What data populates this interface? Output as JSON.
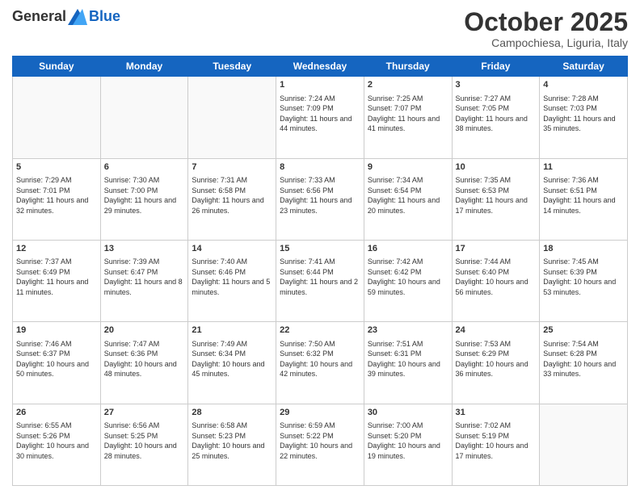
{
  "header": {
    "logo_general": "General",
    "logo_blue": "Blue",
    "month_title": "October 2025",
    "location": "Campochiesa, Liguria, Italy"
  },
  "weekdays": [
    "Sunday",
    "Monday",
    "Tuesday",
    "Wednesday",
    "Thursday",
    "Friday",
    "Saturday"
  ],
  "weeks": [
    [
      {
        "day": "",
        "info": ""
      },
      {
        "day": "",
        "info": ""
      },
      {
        "day": "",
        "info": ""
      },
      {
        "day": "1",
        "info": "Sunrise: 7:24 AM\nSunset: 7:09 PM\nDaylight: 11 hours and 44 minutes."
      },
      {
        "day": "2",
        "info": "Sunrise: 7:25 AM\nSunset: 7:07 PM\nDaylight: 11 hours and 41 minutes."
      },
      {
        "day": "3",
        "info": "Sunrise: 7:27 AM\nSunset: 7:05 PM\nDaylight: 11 hours and 38 minutes."
      },
      {
        "day": "4",
        "info": "Sunrise: 7:28 AM\nSunset: 7:03 PM\nDaylight: 11 hours and 35 minutes."
      }
    ],
    [
      {
        "day": "5",
        "info": "Sunrise: 7:29 AM\nSunset: 7:01 PM\nDaylight: 11 hours and 32 minutes."
      },
      {
        "day": "6",
        "info": "Sunrise: 7:30 AM\nSunset: 7:00 PM\nDaylight: 11 hours and 29 minutes."
      },
      {
        "day": "7",
        "info": "Sunrise: 7:31 AM\nSunset: 6:58 PM\nDaylight: 11 hours and 26 minutes."
      },
      {
        "day": "8",
        "info": "Sunrise: 7:33 AM\nSunset: 6:56 PM\nDaylight: 11 hours and 23 minutes."
      },
      {
        "day": "9",
        "info": "Sunrise: 7:34 AM\nSunset: 6:54 PM\nDaylight: 11 hours and 20 minutes."
      },
      {
        "day": "10",
        "info": "Sunrise: 7:35 AM\nSunset: 6:53 PM\nDaylight: 11 hours and 17 minutes."
      },
      {
        "day": "11",
        "info": "Sunrise: 7:36 AM\nSunset: 6:51 PM\nDaylight: 11 hours and 14 minutes."
      }
    ],
    [
      {
        "day": "12",
        "info": "Sunrise: 7:37 AM\nSunset: 6:49 PM\nDaylight: 11 hours and 11 minutes."
      },
      {
        "day": "13",
        "info": "Sunrise: 7:39 AM\nSunset: 6:47 PM\nDaylight: 11 hours and 8 minutes."
      },
      {
        "day": "14",
        "info": "Sunrise: 7:40 AM\nSunset: 6:46 PM\nDaylight: 11 hours and 5 minutes."
      },
      {
        "day": "15",
        "info": "Sunrise: 7:41 AM\nSunset: 6:44 PM\nDaylight: 11 hours and 2 minutes."
      },
      {
        "day": "16",
        "info": "Sunrise: 7:42 AM\nSunset: 6:42 PM\nDaylight: 10 hours and 59 minutes."
      },
      {
        "day": "17",
        "info": "Sunrise: 7:44 AM\nSunset: 6:40 PM\nDaylight: 10 hours and 56 minutes."
      },
      {
        "day": "18",
        "info": "Sunrise: 7:45 AM\nSunset: 6:39 PM\nDaylight: 10 hours and 53 minutes."
      }
    ],
    [
      {
        "day": "19",
        "info": "Sunrise: 7:46 AM\nSunset: 6:37 PM\nDaylight: 10 hours and 50 minutes."
      },
      {
        "day": "20",
        "info": "Sunrise: 7:47 AM\nSunset: 6:36 PM\nDaylight: 10 hours and 48 minutes."
      },
      {
        "day": "21",
        "info": "Sunrise: 7:49 AM\nSunset: 6:34 PM\nDaylight: 10 hours and 45 minutes."
      },
      {
        "day": "22",
        "info": "Sunrise: 7:50 AM\nSunset: 6:32 PM\nDaylight: 10 hours and 42 minutes."
      },
      {
        "day": "23",
        "info": "Sunrise: 7:51 AM\nSunset: 6:31 PM\nDaylight: 10 hours and 39 minutes."
      },
      {
        "day": "24",
        "info": "Sunrise: 7:53 AM\nSunset: 6:29 PM\nDaylight: 10 hours and 36 minutes."
      },
      {
        "day": "25",
        "info": "Sunrise: 7:54 AM\nSunset: 6:28 PM\nDaylight: 10 hours and 33 minutes."
      }
    ],
    [
      {
        "day": "26",
        "info": "Sunrise: 6:55 AM\nSunset: 5:26 PM\nDaylight: 10 hours and 30 minutes."
      },
      {
        "day": "27",
        "info": "Sunrise: 6:56 AM\nSunset: 5:25 PM\nDaylight: 10 hours and 28 minutes."
      },
      {
        "day": "28",
        "info": "Sunrise: 6:58 AM\nSunset: 5:23 PM\nDaylight: 10 hours and 25 minutes."
      },
      {
        "day": "29",
        "info": "Sunrise: 6:59 AM\nSunset: 5:22 PM\nDaylight: 10 hours and 22 minutes."
      },
      {
        "day": "30",
        "info": "Sunrise: 7:00 AM\nSunset: 5:20 PM\nDaylight: 10 hours and 19 minutes."
      },
      {
        "day": "31",
        "info": "Sunrise: 7:02 AM\nSunset: 5:19 PM\nDaylight: 10 hours and 17 minutes."
      },
      {
        "day": "",
        "info": ""
      }
    ]
  ]
}
